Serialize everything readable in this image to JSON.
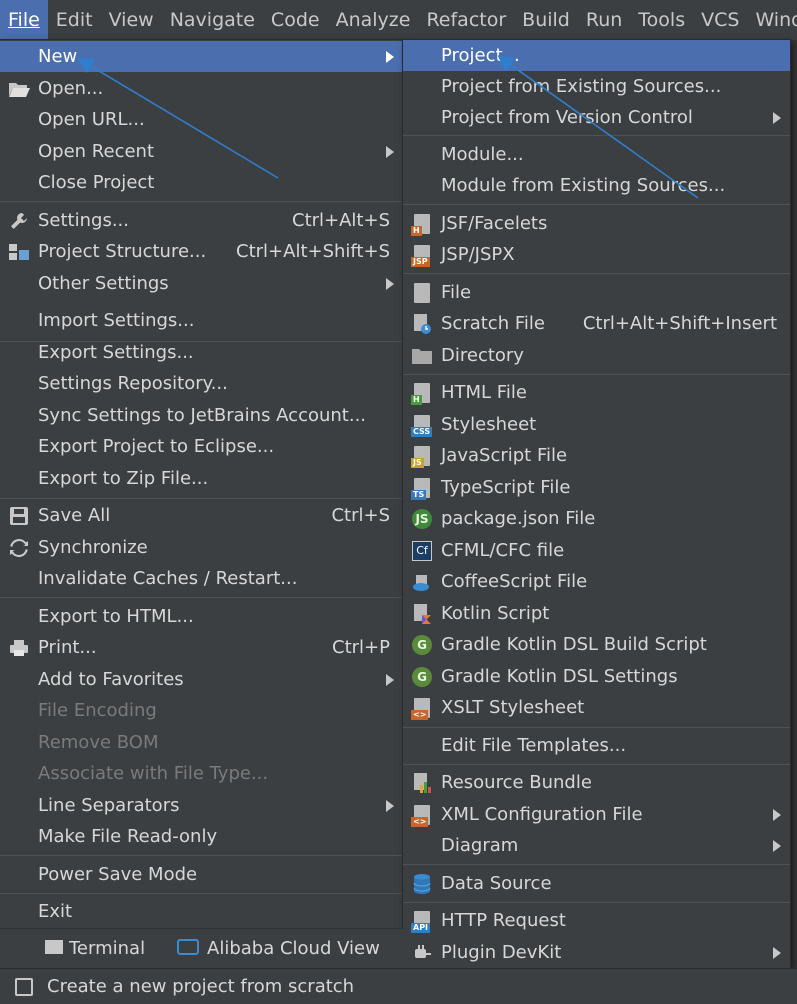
{
  "menubar": [
    "File",
    "Edit",
    "View",
    "Navigate",
    "Code",
    "Analyze",
    "Refactor",
    "Build",
    "Run",
    "Tools",
    "VCS",
    "Windo"
  ],
  "file_menu": {
    "items": [
      {
        "label": "New",
        "submenu": true,
        "selected": true
      },
      {
        "label": "Open...",
        "icon": "folder-open-icon"
      },
      {
        "label": "Open URL..."
      },
      {
        "label": "Open Recent",
        "submenu": true
      },
      {
        "label": "Close Project"
      },
      {
        "label": "Settings...",
        "icon": "wrench-icon",
        "shortcut": "Ctrl+Alt+S"
      },
      {
        "label": "Project Structure...",
        "icon": "project-structure-icon",
        "shortcut": "Ctrl+Alt+Shift+S"
      },
      {
        "label": "Other Settings",
        "submenu": true
      },
      {
        "label": "Import Settings..."
      },
      {
        "label": "Export Settings..."
      },
      {
        "label": "Settings Repository..."
      },
      {
        "label": "Sync Settings to JetBrains Account..."
      },
      {
        "label": "Export Project to Eclipse..."
      },
      {
        "label": "Export to Zip File..."
      },
      {
        "label": "Save All",
        "icon": "save-icon",
        "shortcut": "Ctrl+S"
      },
      {
        "label": "Synchronize",
        "icon": "sync-icon"
      },
      {
        "label": "Invalidate Caches / Restart..."
      },
      {
        "label": "Export to HTML..."
      },
      {
        "label": "Print...",
        "icon": "printer-icon",
        "shortcut": "Ctrl+P"
      },
      {
        "label": "Add to Favorites",
        "submenu": true
      },
      {
        "label": "File Encoding",
        "disabled": true
      },
      {
        "label": "Remove BOM",
        "disabled": true
      },
      {
        "label": "Associate with File Type...",
        "disabled": true
      },
      {
        "label": "Line Separators",
        "submenu": true
      },
      {
        "label": "Make File Read-only"
      },
      {
        "label": "Power Save Mode"
      },
      {
        "label": "Exit"
      }
    ]
  },
  "new_submenu": {
    "items": [
      {
        "label": "Project...",
        "selected": true
      },
      {
        "label": "Project from Existing Sources..."
      },
      {
        "label": "Project from Version Control",
        "submenu": true
      },
      {
        "label": "Module..."
      },
      {
        "label": "Module from Existing Sources..."
      },
      {
        "label": "JSF/Facelets",
        "icon": "jsf-file-icon",
        "tag": "H"
      },
      {
        "label": "JSP/JSPX",
        "icon": "jsp-file-icon",
        "tag": "JSP"
      },
      {
        "label": "File",
        "icon": "file-icon"
      },
      {
        "label": "Scratch File",
        "icon": "scratch-file-icon",
        "shortcut": "Ctrl+Alt+Shift+Insert"
      },
      {
        "label": "Directory",
        "icon": "folder-icon"
      },
      {
        "label": "HTML File",
        "icon": "html-file-icon",
        "tag": "H"
      },
      {
        "label": "Stylesheet",
        "icon": "css-file-icon",
        "tag": "CSS"
      },
      {
        "label": "JavaScript File",
        "icon": "js-file-icon",
        "tag": "JS"
      },
      {
        "label": "TypeScript File",
        "icon": "ts-file-icon",
        "tag": "TS"
      },
      {
        "label": "package.json File",
        "icon": "nodejs-icon",
        "tag": "JS"
      },
      {
        "label": "CFML/CFC file",
        "icon": "cfml-icon",
        "tag": "Cf"
      },
      {
        "label": "CoffeeScript File",
        "icon": "coffeescript-icon"
      },
      {
        "label": "Kotlin Script",
        "icon": "kotlin-icon"
      },
      {
        "label": "Gradle Kotlin DSL Build Script",
        "icon": "gradle-icon",
        "tag": "G"
      },
      {
        "label": "Gradle Kotlin DSL Settings",
        "icon": "gradle-icon",
        "tag": "G"
      },
      {
        "label": "XSLT Stylesheet",
        "icon": "xslt-icon",
        "tag": "<>"
      },
      {
        "label": "Edit File Templates..."
      },
      {
        "label": "Resource Bundle",
        "icon": "resource-bundle-icon"
      },
      {
        "label": "XML Configuration File",
        "icon": "xml-file-icon",
        "tag": "<>",
        "submenu": true
      },
      {
        "label": "Diagram",
        "submenu": true
      },
      {
        "label": "Data Source",
        "icon": "database-icon"
      },
      {
        "label": "HTTP Request",
        "icon": "http-request-icon",
        "tag": "API"
      },
      {
        "label": "Plugin DevKit",
        "icon": "plugin-icon",
        "submenu": true
      }
    ]
  },
  "toolbar": {
    "terminal": "Terminal",
    "alibaba": "Alibaba Cloud View"
  },
  "status": {
    "text": "Create a new project from scratch"
  },
  "colors": {
    "selection": "#4b6eaf",
    "menu_bg": "#3c3f41",
    "arrow": "#2f7fcf"
  }
}
